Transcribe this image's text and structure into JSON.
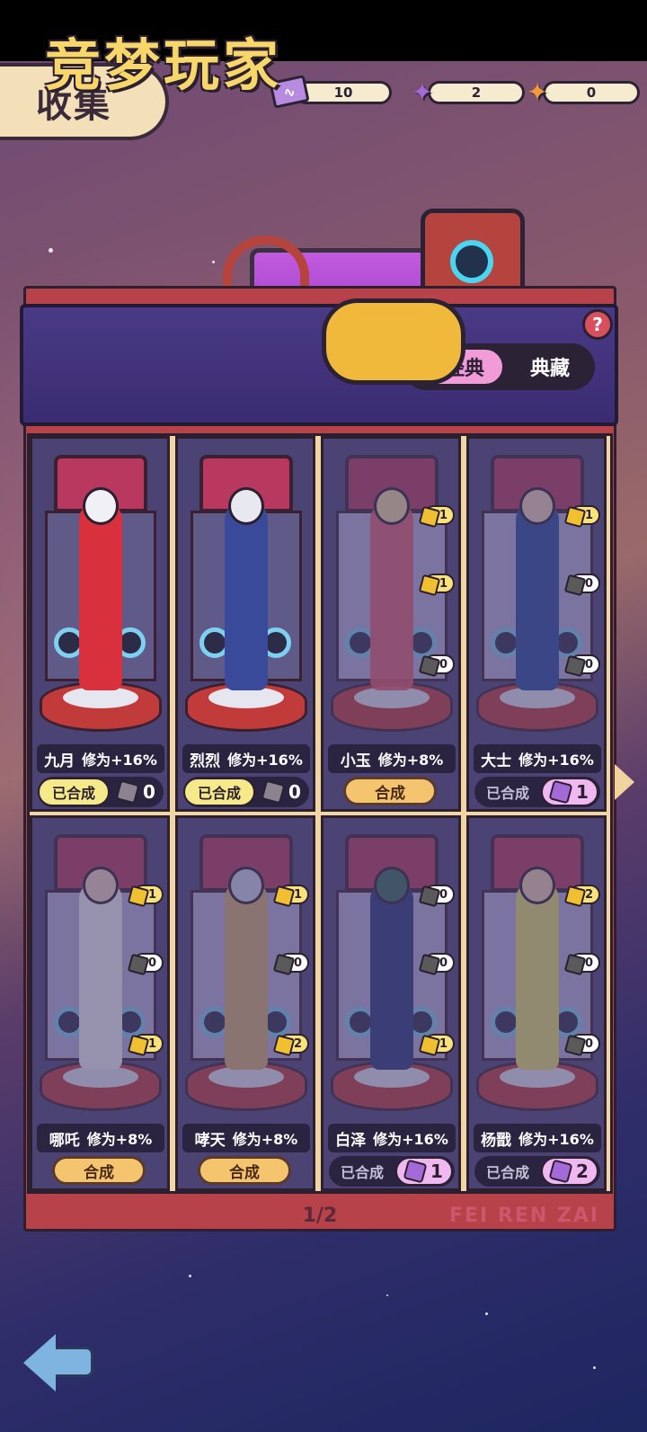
{
  "header": {
    "title": "收集"
  },
  "currencies": [
    {
      "icon": "ticket-icon",
      "value": "10"
    },
    {
      "icon": "purple-puzzle-icon",
      "value": "2"
    },
    {
      "icon": "orange-puzzle-icon",
      "value": "0"
    }
  ],
  "banner": {
    "title": "竞梦玩家",
    "help": "?",
    "tabs": {
      "classic": "经典",
      "collection": "典藏"
    }
  },
  "cards": [
    {
      "name": "九月",
      "bonus": "修为+16%",
      "status": "已合成",
      "count": "0",
      "badges": []
    },
    {
      "name": "烈烈",
      "bonus": "修为+16%",
      "status": "已合成",
      "count": "0",
      "badges": []
    },
    {
      "name": "小玉",
      "bonus": "修为+8%",
      "action": "合成",
      "badges": [
        "1",
        "1",
        "0"
      ]
    },
    {
      "name": "大士",
      "bonus": "修为+16%",
      "status": "已合成",
      "count": "1",
      "badges": [
        "1",
        "0",
        "0"
      ]
    },
    {
      "name": "哪吒",
      "bonus": "修为+8%",
      "action": "合成",
      "badges": [
        "1",
        "0",
        "1"
      ]
    },
    {
      "name": "哮天",
      "bonus": "修为+8%",
      "action": "合成",
      "badges": [
        "1",
        "0",
        "2"
      ]
    },
    {
      "name": "白泽",
      "bonus": "修为+16%",
      "status": "已合成",
      "count": "1",
      "badges": [
        "0",
        "0",
        "1"
      ]
    },
    {
      "name": "杨戬",
      "bonus": "修为+16%",
      "status": "已合成",
      "count": "2",
      "badges": [
        "2",
        "0",
        "0"
      ]
    }
  ],
  "pagination": {
    "label": "1/2"
  },
  "watermark": "FEI REN ZAI"
}
